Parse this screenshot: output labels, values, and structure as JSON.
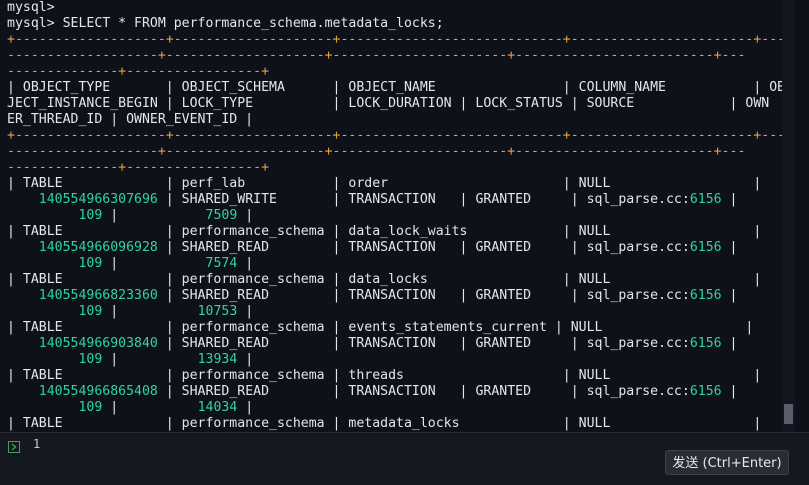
{
  "colors": {
    "background": "#0f111a",
    "text": "#e6e6e6",
    "separator": "#e9a23b",
    "number": "#2fd69a",
    "input_bg": "#16181f",
    "marker": "#3fa15a"
  },
  "terminal": {
    "lines": [
      [
        [
          "t",
          "mysql>"
        ]
      ],
      [
        [
          "t",
          "mysql> SELECT * FROM performance_schema.metadata_locks;"
        ]
      ],
      [
        [
          "s",
          "+-------------------+--------------------+----------------------------+-----------------------+---"
        ]
      ],
      [
        [
          "s",
          "-------------------+--------------------+----------------------+-------------------------+---"
        ]
      ],
      [
        [
          "s",
          "--------------+-----------------+"
        ]
      ],
      [
        [
          "t",
          "| OBJECT_TYPE       | OBJECT_SCHEMA      | OBJECT_NAME                | COLUMN_NAME           | OB"
        ]
      ],
      [
        [
          "t",
          "JECT_INSTANCE_BEGIN | LOCK_TYPE          | LOCK_DURATION | LOCK_STATUS | SOURCE            | OWN"
        ]
      ],
      [
        [
          "t",
          "ER_THREAD_ID | OWNER_EVENT_ID |"
        ]
      ],
      [
        [
          "s",
          "+-------------------+--------------------+----------------------------+-----------------------+---"
        ]
      ],
      [
        [
          "s",
          "-------------------+--------------------+----------------------+-------------------------+---"
        ]
      ],
      [
        [
          "s",
          "--------------+-----------------+"
        ]
      ],
      [
        [
          "t",
          "| TABLE             | perf_lab           | order                      | NULL                  |"
        ]
      ],
      [
        [
          "t",
          "    "
        ],
        [
          "n",
          "140554966307696"
        ],
        [
          "t",
          " | SHARED_WRITE       | TRANSACTION   | GRANTED     | sql_parse.cc:"
        ],
        [
          "n",
          "6156"
        ],
        [
          "t",
          " |"
        ]
      ],
      [
        [
          "t",
          "         "
        ],
        [
          "n",
          "109"
        ],
        [
          "t",
          " |           "
        ],
        [
          "n",
          "7509"
        ],
        [
          "t",
          " |"
        ]
      ],
      [
        [
          "t",
          "| TABLE             | performance_schema | data_lock_waits            | NULL                  |"
        ]
      ],
      [
        [
          "t",
          "    "
        ],
        [
          "n",
          "140554966096928"
        ],
        [
          "t",
          " | SHARED_READ        | TRANSACTION   | GRANTED     | sql_parse.cc:"
        ],
        [
          "n",
          "6156"
        ],
        [
          "t",
          " |"
        ]
      ],
      [
        [
          "t",
          "         "
        ],
        [
          "n",
          "109"
        ],
        [
          "t",
          " |           "
        ],
        [
          "n",
          "7574"
        ],
        [
          "t",
          " |"
        ]
      ],
      [
        [
          "t",
          "| TABLE             | performance_schema | data_locks                 | NULL                  |"
        ]
      ],
      [
        [
          "t",
          "    "
        ],
        [
          "n",
          "140554966823360"
        ],
        [
          "t",
          " | SHARED_READ        | TRANSACTION   | GRANTED     | sql_parse.cc:"
        ],
        [
          "n",
          "6156"
        ],
        [
          "t",
          " |"
        ]
      ],
      [
        [
          "t",
          "         "
        ],
        [
          "n",
          "109"
        ],
        [
          "t",
          " |          "
        ],
        [
          "n",
          "10753"
        ],
        [
          "t",
          " |"
        ]
      ],
      [
        [
          "t",
          "| TABLE             | performance_schema | events_statements_current | NULL                  |"
        ]
      ],
      [
        [
          "t",
          "    "
        ],
        [
          "n",
          "140554966903840"
        ],
        [
          "t",
          " | SHARED_READ        | TRANSACTION   | GRANTED     | sql_parse.cc:"
        ],
        [
          "n",
          "6156"
        ],
        [
          "t",
          " |"
        ]
      ],
      [
        [
          "t",
          "         "
        ],
        [
          "n",
          "109"
        ],
        [
          "t",
          " |          "
        ],
        [
          "n",
          "13934"
        ],
        [
          "t",
          " |"
        ]
      ],
      [
        [
          "t",
          "| TABLE             | performance_schema | threads                    | NULL                  |"
        ]
      ],
      [
        [
          "t",
          "    "
        ],
        [
          "n",
          "140554966865408"
        ],
        [
          "t",
          " | SHARED_READ        | TRANSACTION   | GRANTED     | sql_parse.cc:"
        ],
        [
          "n",
          "6156"
        ],
        [
          "t",
          " |"
        ]
      ],
      [
        [
          "t",
          "         "
        ],
        [
          "n",
          "109"
        ],
        [
          "t",
          " |          "
        ],
        [
          "n",
          "14034"
        ],
        [
          "t",
          " |"
        ]
      ],
      [
        [
          "t",
          "| TABLE             | performance_schema | metadata_locks             | NULL                  |"
        ]
      ]
    ]
  },
  "editor": {
    "line_number": "1",
    "marker_icon": "chevron-right-box-icon"
  },
  "actions": {
    "send_label": "发送 (Ctrl+Enter)"
  }
}
